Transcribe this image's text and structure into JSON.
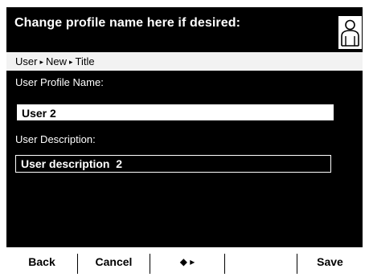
{
  "header": {
    "title": "Change profile name here if desired:",
    "icon": "user-profile-icon"
  },
  "breadcrumb": {
    "items": [
      "User",
      "New",
      "Title"
    ],
    "separator": "▸"
  },
  "form": {
    "profile_name_label": "User Profile Name:",
    "profile_name_value": "User 2",
    "description_label": "User Description:",
    "description_value": "User description  2"
  },
  "softkeys": {
    "back": "Back",
    "cancel": "Cancel",
    "nav": "◆ ▸",
    "empty": "",
    "save": "Save"
  },
  "colors": {
    "background": "#000000",
    "text": "#ffffff",
    "highlight": "#ffffff"
  }
}
